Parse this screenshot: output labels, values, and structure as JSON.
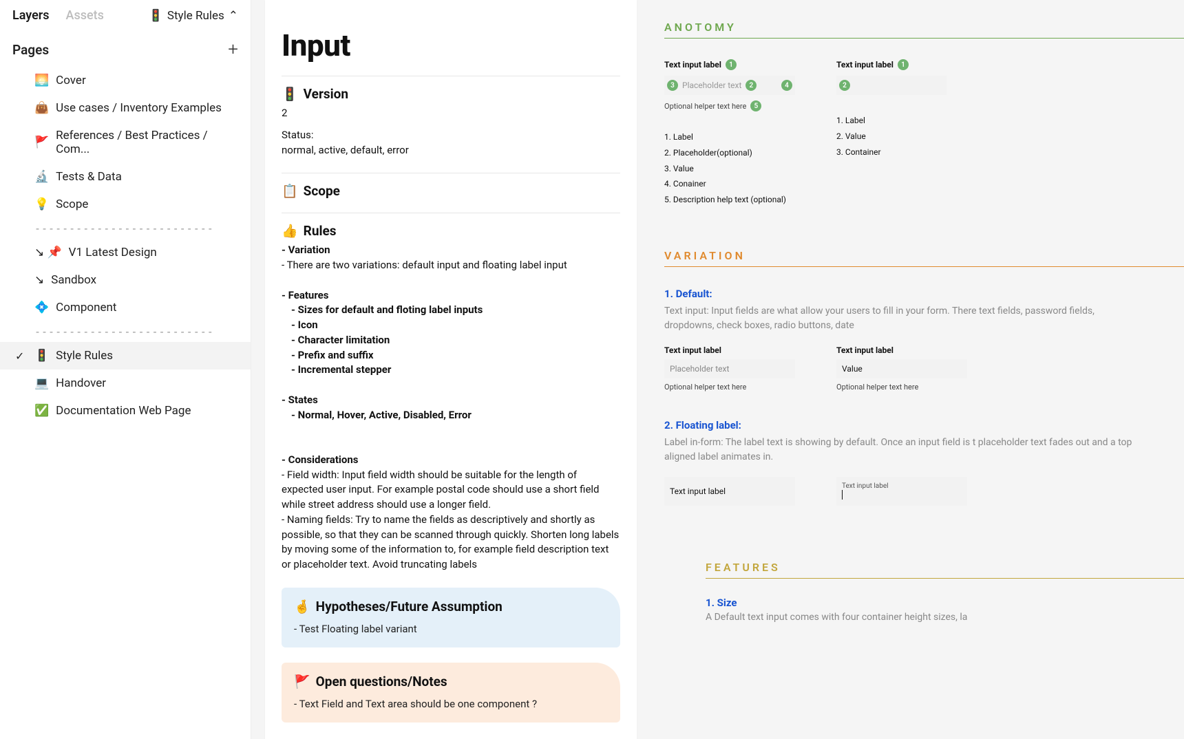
{
  "sidebar": {
    "tabs": {
      "layers": "Layers",
      "assets": "Assets"
    },
    "rules_label": "Style Rules",
    "rules_icon": "🚦",
    "pages_label": "Pages",
    "items": [
      {
        "icon": "🌅",
        "label": "Cover"
      },
      {
        "icon": "👜",
        "label": "Use cases / Inventory Examples"
      },
      {
        "icon": "🚩",
        "label": "References  / Best Practices / Com..."
      },
      {
        "icon": "🔬",
        "label": "Tests & Data"
      },
      {
        "icon": "💡",
        "label": "Scope"
      },
      {
        "divider": "--------------------------"
      },
      {
        "icon": "↘ 📌",
        "label": "V1  Latest Design"
      },
      {
        "icon": "↘",
        "label": "Sandbox"
      },
      {
        "icon": "💠",
        "label": "Component"
      },
      {
        "divider": "--------------------------"
      },
      {
        "icon": "🚦",
        "label": "Style Rules",
        "selected": true
      },
      {
        "icon": "💻",
        "label": "Handover"
      },
      {
        "icon": "✅",
        "label": "Documentation Web Page"
      }
    ]
  },
  "doc": {
    "title": "Input",
    "version": {
      "icon": "🚦",
      "heading": "Version",
      "value": "2",
      "status_label": "Status:",
      "status_value": "normal, active, default, error"
    },
    "scope": {
      "icon": "📋",
      "heading": "Scope"
    },
    "rules": {
      "icon": "👍",
      "heading": "Rules",
      "variation_h": "- Variation",
      "variation_body": "- There are two variations: default input and floating label input",
      "features_h": "- Features",
      "features": [
        "- Sizes for default and floting label inputs",
        "- Icon",
        "- Character limitation",
        "- Prefix and suffix",
        "- Incremental stepper"
      ],
      "states_h": "- States",
      "states_body": "- Normal, Hover, Active, Disabled, Error",
      "consider_h": "- Considerations",
      "consider_body1": "- Field width: Input field width should be suitable for the length of expected user input. For example postal code should use a short field while street address should use a longer field.",
      "consider_body2": "- Naming fields: Try to name the fields as descriptively and shortly as possible, so that they can be scanned through quickly. Shorten long labels by moving some of the information to, for example field description text or placeholder text. Avoid truncating labels"
    },
    "hypotheses": {
      "icon": "🤞",
      "heading": "Hypotheses/Future Assumption",
      "body": "- Test Floating label variant"
    },
    "open_q": {
      "icon": "🚩",
      "heading": "Open questions/Notes",
      "body": "- Text Field and Text area should be one component ?"
    }
  },
  "preview": {
    "anotomy": {
      "title": "ANOTOMY",
      "left_label": "Text input label",
      "placeholder": "Placeholder text",
      "helper": "Optional helper text here",
      "left_list": [
        "1. Label",
        "2. Placeholder(optional)",
        "3. Value",
        "4. Conainer",
        "5. Description help text (optional)"
      ],
      "right_label": "Text input label",
      "right_list": [
        "1. Label",
        "2. Value",
        "3. Container"
      ]
    },
    "variation": {
      "title": "VARIATION",
      "default_h": "1. Default:",
      "default_desc": "Text input: Input fields are what allow your users to fill in your form. There text fields, password fields, dropdowns, check boxes, radio buttons, date",
      "lbl": "Text input label",
      "placeholder": "Placeholder text",
      "value": "Value",
      "helper": "Optional helper text here",
      "float_h": "2. Floating label:",
      "float_desc": "Label in-form: The label text is showing by default. Once an input field is t placeholder text fades out and a top aligned label animates in.",
      "float_lbl": "Text input label",
      "float_tiny": "Text input label"
    },
    "features": {
      "title": "FEATURES",
      "size_h": "1. Size",
      "size_desc": "A  Default text input comes with four container height sizes, la"
    }
  }
}
